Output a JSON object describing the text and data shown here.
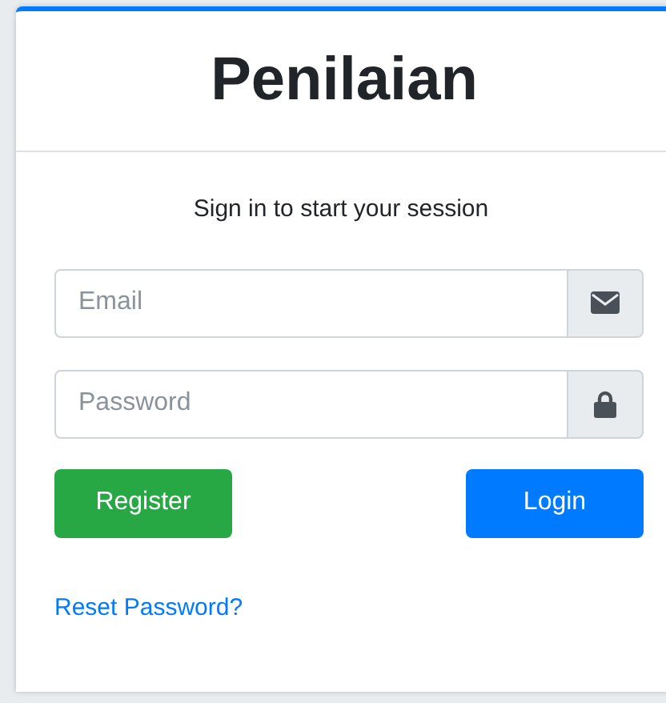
{
  "card": {
    "title": "Penilaian",
    "message": "Sign in to start your session"
  },
  "fields": [
    {
      "placeholder": "Email",
      "kind": "email"
    },
    {
      "placeholder": "Password",
      "kind": "password"
    }
  ],
  "buttons": [
    {
      "label": "Register",
      "kind": "success"
    },
    {
      "label": "Login",
      "kind": "primary"
    }
  ],
  "link": "Reset Password?"
}
